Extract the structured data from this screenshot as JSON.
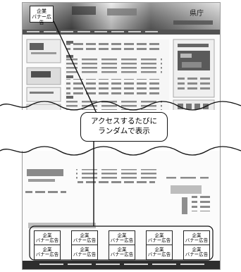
{
  "labels": {
    "corner_ad_line1": "企業",
    "corner_ad_line2": "バナー広告",
    "callout_line1": "アクセスするたびに",
    "callout_line2": "ランダムで表示"
  },
  "top_site_header_text": "県庁",
  "ad_grid_label_line1": "企業",
  "ad_grid_label_line2": "バナー広告"
}
